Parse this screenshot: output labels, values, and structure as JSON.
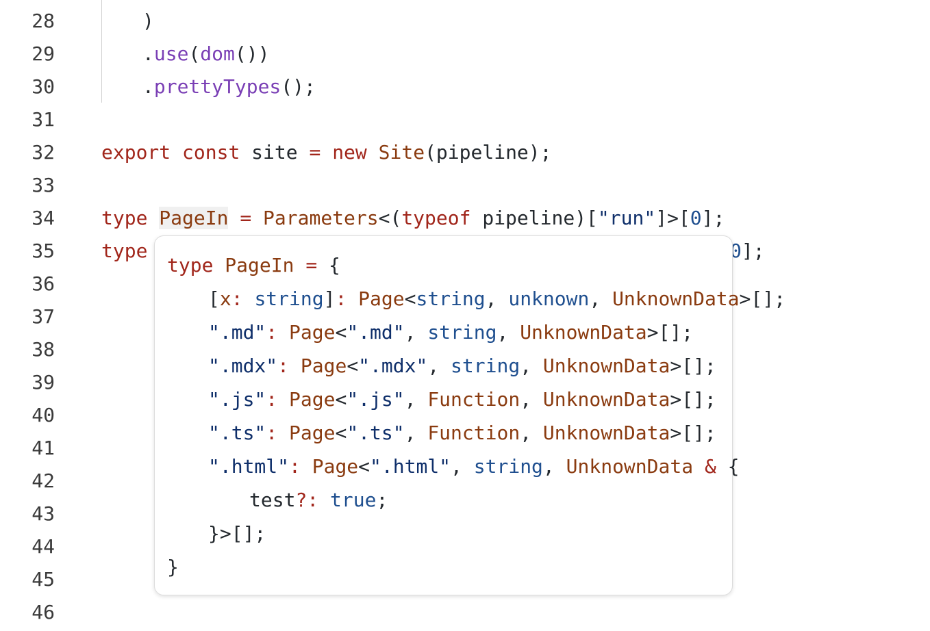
{
  "gutter": {
    "line_numbers": [
      "28",
      "29",
      "30",
      "31",
      "32",
      "33",
      "34",
      "35",
      "36",
      "37",
      "38",
      "39",
      "40",
      "41",
      "42",
      "43",
      "44",
      "45",
      "46"
    ]
  },
  "code": {
    "l28": {
      "close_paren": ")"
    },
    "l29": {
      "dot": ".",
      "method": "use",
      "open": "(",
      "call": "dom",
      "close": "())"
    },
    "l30": {
      "dot": ".",
      "method": "prettyTypes",
      "rest": "();"
    },
    "l32": {
      "export": "export",
      "const": "const",
      "name": " site ",
      "eq": "=",
      "new": "new",
      "cls": "Site",
      "args": "(pipeline);"
    },
    "l34": {
      "type": "type",
      "name": "PageIn",
      "eq": "=",
      "params": "Parameters",
      "lt": "<(",
      "typeof": "typeof",
      "mid": " pipeline)[",
      "run": "\"run\"",
      "mid2": "]>[",
      "zero": "0",
      "end": "];"
    },
    "l35": {
      "type": "type",
      "tail_digit": "0",
      "tail_end": "];"
    }
  },
  "tooltip": {
    "t1": {
      "type": "type",
      "name": "PageIn",
      "eq": "=",
      "brace": "{"
    },
    "t2": {
      "open": "[",
      "x": "x",
      "colon": ":",
      "string": "string",
      "close": "]",
      "colon2": ":",
      "page": "Page",
      "lt": "<",
      "string2": "string",
      "comma": ", ",
      "unknown": "unknown",
      "comma2": ", ",
      "ud": "UnknownData",
      "end": ">[];"
    },
    "t3": {
      "key": "\".md\"",
      "colon": ":",
      "page": "Page",
      "lt": "<",
      "k2": "\".md\"",
      "comma": ", ",
      "string": "string",
      "comma2": ", ",
      "ud": "UnknownData",
      "end": ">[];"
    },
    "t4": {
      "key": "\".mdx\"",
      "colon": ":",
      "page": "Page",
      "lt": "<",
      "k2": "\".mdx\"",
      "comma": ", ",
      "string": "string",
      "comma2": ", ",
      "ud": "UnknownData",
      "end": ">[];"
    },
    "t5": {
      "key": "\".js\"",
      "colon": ":",
      "page": "Page",
      "lt": "<",
      "k2": "\".js\"",
      "comma": ", ",
      "fn": "Function",
      "comma2": ", ",
      "ud": "UnknownData",
      "end": ">[];"
    },
    "t6": {
      "key": "\".ts\"",
      "colon": ":",
      "page": "Page",
      "lt": "<",
      "k2": "\".ts\"",
      "comma": ", ",
      "fn": "Function",
      "comma2": ", ",
      "ud": "UnknownData",
      "end": ">[];"
    },
    "t7": {
      "key": "\".html\"",
      "colon": ":",
      "page": "Page",
      "lt": "<",
      "k2": "\".html\"",
      "comma": ", ",
      "string": "string",
      "comma2": ", ",
      "ud": "UnknownData",
      "amp": "&",
      "brace": "{"
    },
    "t8": {
      "prop": "test",
      "opt": "?:",
      "val": "true",
      "semi": ";"
    },
    "t9": {
      "end": "}>[];"
    },
    "t10": {
      "brace": "}"
    }
  },
  "colors": {
    "keyword": "#a1261b",
    "function": "#7a3fb5",
    "type": "#8a3b10",
    "primitive": "#1f4f8f"
  }
}
